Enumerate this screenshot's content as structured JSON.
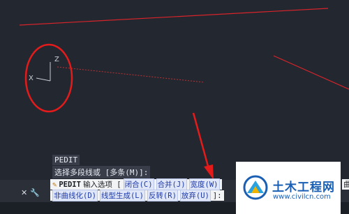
{
  "ucs": {
    "x_label": "X",
    "z_label": "Z"
  },
  "history": {
    "line1": "PEDIT",
    "line2": "选择多段线或 [多条(M)]:"
  },
  "controls": {
    "close_label": "✕",
    "wrench_label": "🔧"
  },
  "prompt": {
    "command": "PEDIT",
    "intro": "输入选项 [",
    "options1": [
      "闭合(C)",
      "合并(J)",
      "宽度(W)"
    ],
    "tail1": "曲",
    "options2": [
      "非曲线化(D)",
      "线型生成(L)",
      "反转(R)",
      "放弃(U)"
    ],
    "end2": "]:"
  },
  "logo": {
    "title": "土木工程网",
    "url": "www.civilcn.com"
  },
  "colors": {
    "accent_red": "#e02020",
    "background": "#222730"
  }
}
